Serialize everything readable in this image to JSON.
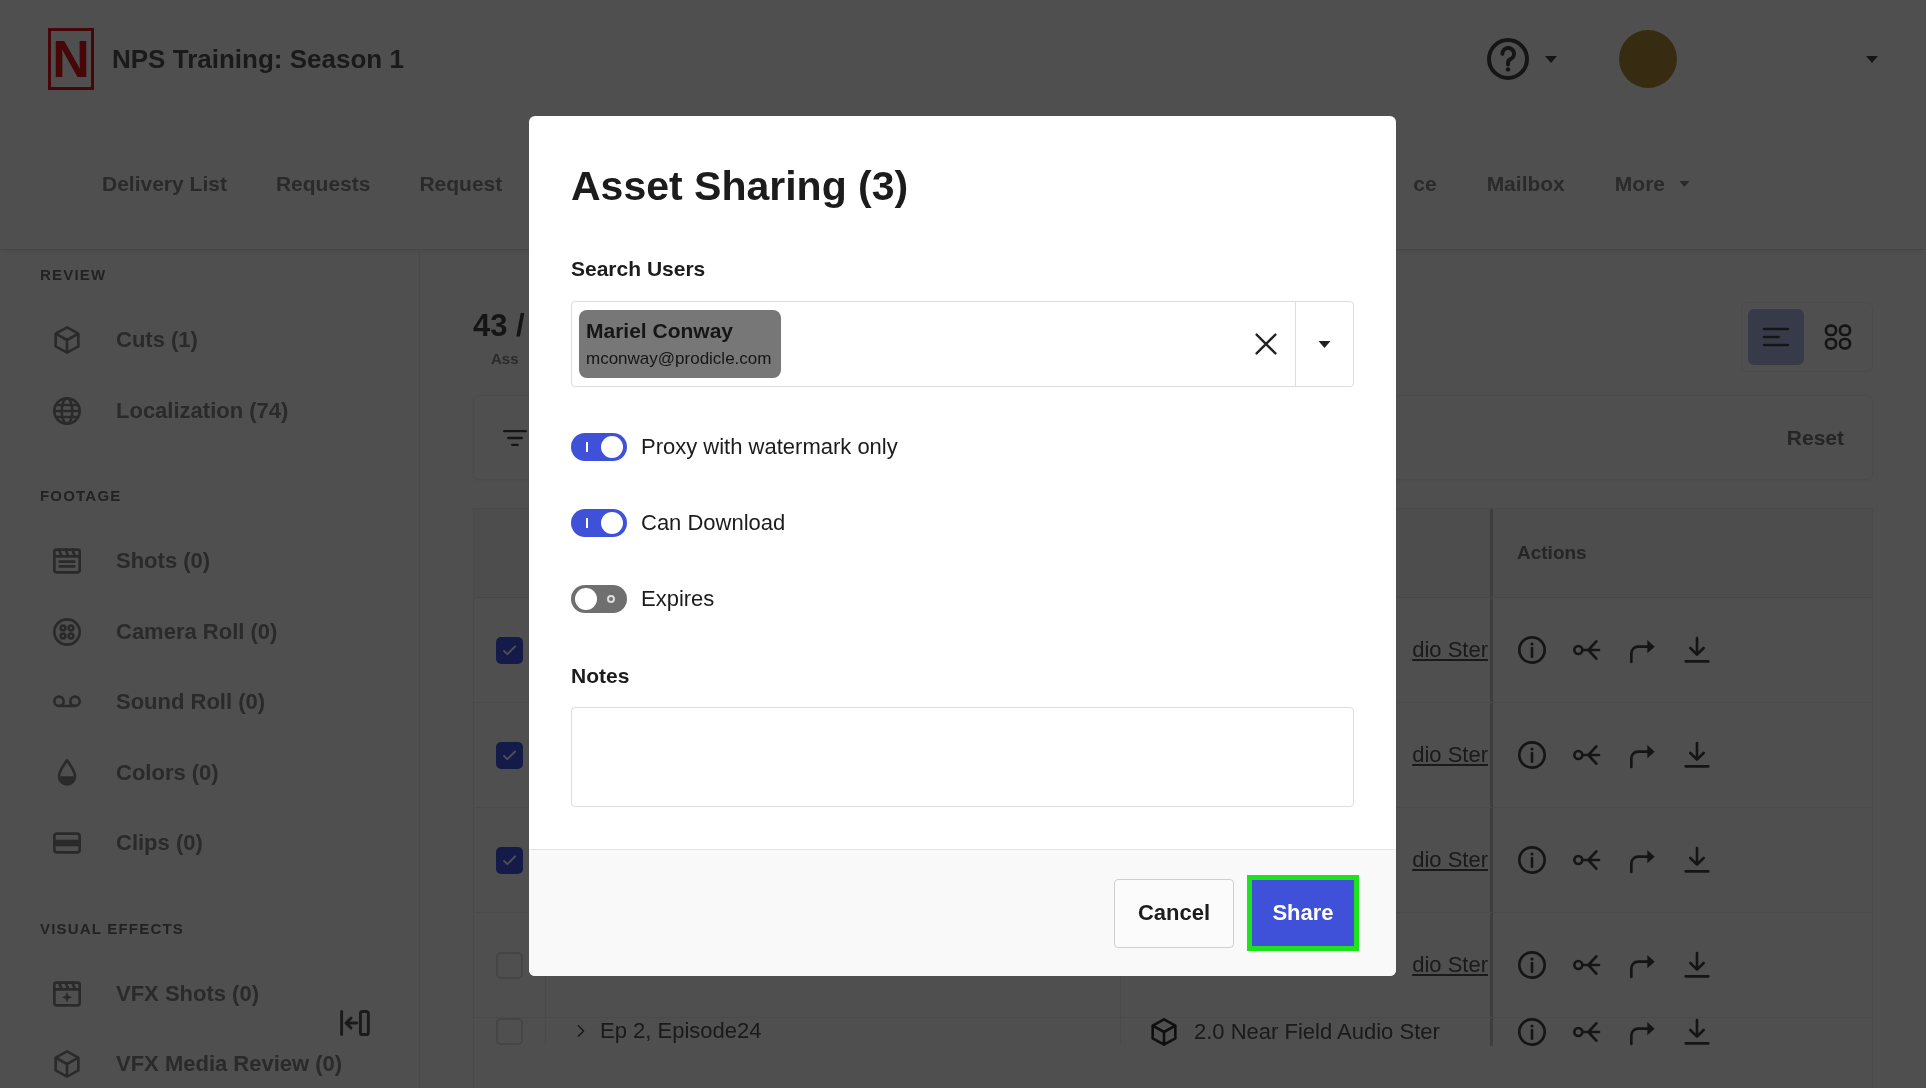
{
  "header": {
    "logo": {
      "letter": "N"
    },
    "title": "NPS Training: Season 1"
  },
  "nav": {
    "items": [
      {
        "label": "Delivery List",
        "kind": "link"
      },
      {
        "label": "Requests",
        "kind": "link"
      },
      {
        "label": "Request",
        "kind": "link"
      },
      {
        "label": "ce",
        "kind": "link"
      },
      {
        "label": "Mailbox",
        "kind": "link"
      },
      {
        "label": "More",
        "kind": "menu"
      }
    ]
  },
  "sidebar": {
    "sections": [
      {
        "heading": "REVIEW",
        "items": [
          {
            "label": "Cuts (1)"
          },
          {
            "label": "Localization (74)"
          }
        ]
      },
      {
        "heading": "FOOTAGE",
        "items": [
          {
            "label": "Shots (0)"
          },
          {
            "label": "Camera Roll (0)"
          },
          {
            "label": "Sound Roll (0)"
          },
          {
            "label": "Colors (0)"
          },
          {
            "label": "Clips (0)"
          }
        ]
      },
      {
        "heading": "VISUAL EFFECTS",
        "items": [
          {
            "label": "VFX Shots (0)"
          },
          {
            "label": "VFX Media Review (0)"
          }
        ]
      }
    ]
  },
  "content": {
    "count": "43 /",
    "caption": "Ass",
    "view_modes": [
      {
        "selected": true
      },
      {
        "selected": false
      }
    ],
    "filter_bar": {
      "reset": "Reset"
    }
  },
  "table": {
    "columns": [
      {
        "label": "Actions"
      }
    ],
    "rows": [
      {
        "kind": "asset",
        "checked": true,
        "file": "dio Ster"
      },
      {
        "kind": "asset",
        "checked": true,
        "file": "dio Ster"
      },
      {
        "kind": "asset",
        "checked": true,
        "file": "dio Ster"
      },
      {
        "kind": "asset",
        "checked": false,
        "file": "dio Ster"
      },
      {
        "kind": "group",
        "checked": false,
        "name": "Ep 2, Episode24",
        "file": "2.0 Near Field Audio Ster"
      }
    ]
  },
  "dialog": {
    "title": "Asset Sharing (3)",
    "search_label": "Search Users",
    "selected_users": [
      {
        "name": "Mariel Conway",
        "email": "mconway@prodicle.com"
      }
    ],
    "options": [
      {
        "label": "Proxy with watermark only",
        "on": true
      },
      {
        "label": "Can Download",
        "on": true
      },
      {
        "label": "Expires",
        "on": false
      }
    ],
    "notes_label": "Notes",
    "buttons": [
      {
        "label": "Cancel",
        "kind": "secondary",
        "focused": false
      },
      {
        "label": "Share",
        "kind": "primary",
        "focused": true
      }
    ]
  }
}
